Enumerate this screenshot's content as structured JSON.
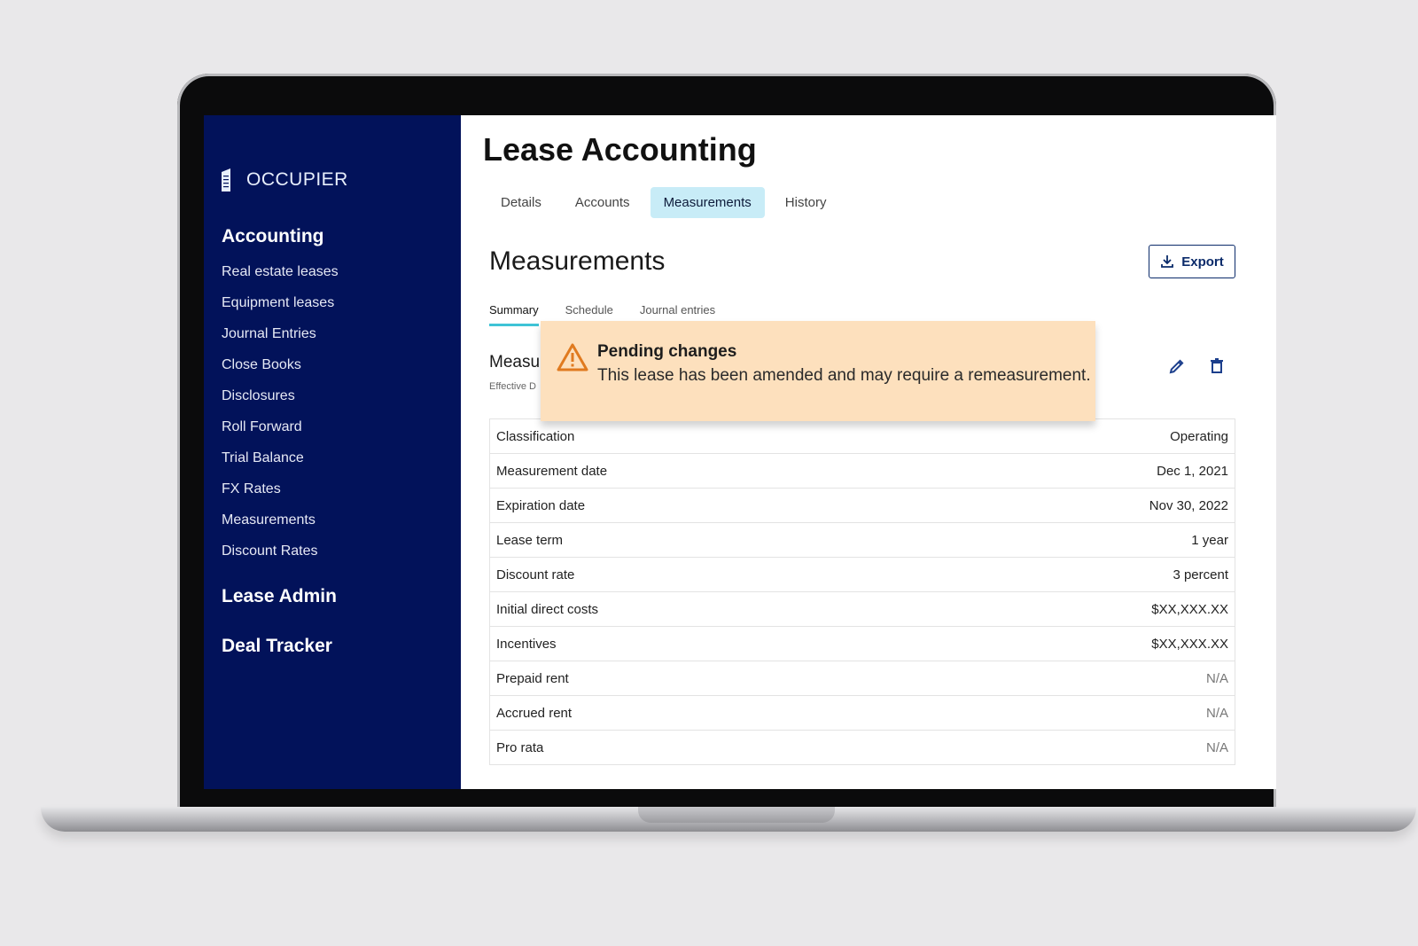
{
  "logo": {
    "text": "OCCUPIER"
  },
  "sidebar": {
    "section_accounting": "Accounting",
    "items": [
      "Real estate leases",
      "Equipment leases",
      "Journal Entries",
      "Close Books",
      "Disclosures",
      "Roll Forward",
      "Trial Balance",
      "FX Rates",
      "Measurements",
      "Discount Rates"
    ],
    "section_lease_admin": "Lease Admin",
    "section_deal_tracker": "Deal Tracker"
  },
  "header": {
    "title": "Lease Accounting"
  },
  "tabs": [
    {
      "label": "Details",
      "active": false
    },
    {
      "label": "Accounts",
      "active": false
    },
    {
      "label": "Measurements",
      "active": true
    },
    {
      "label": "History",
      "active": false
    }
  ],
  "section": {
    "title": "Measurements",
    "export_label": "Export"
  },
  "subtabs": [
    {
      "label": "Summary",
      "active": true
    },
    {
      "label": "Schedule",
      "active": false
    },
    {
      "label": "Journal entries",
      "active": false
    }
  ],
  "measurement": {
    "heading": "Measu",
    "sub": "Effective D"
  },
  "banner": {
    "title": "Pending changes",
    "message": "This lease has been amended and may require a remeasurement."
  },
  "table": [
    {
      "label": "Classification",
      "value": "Operating"
    },
    {
      "label": "Measurement date",
      "value": "Dec 1, 2021"
    },
    {
      "label": "Expiration date",
      "value": "Nov 30, 2022"
    },
    {
      "label": "Lease term",
      "value": "1 year"
    },
    {
      "label": "Discount rate",
      "value": "3 percent"
    },
    {
      "label": "Initial direct costs",
      "value": "$XX,XXX.XX"
    },
    {
      "label": "Incentives",
      "value": "$XX,XXX.XX"
    },
    {
      "label": "Prepaid rent",
      "value": "N/A"
    },
    {
      "label": "Accrued rent",
      "value": "N/A"
    },
    {
      "label": "Pro rata",
      "value": "N/A"
    }
  ],
  "colors": {
    "sidebar_bg": "#02125a",
    "tab_active_bg": "#c8ecf7",
    "subtab_underline": "#3fc3d6",
    "banner_bg": "#fde0bd",
    "warning_icon": "#e07a1f"
  }
}
